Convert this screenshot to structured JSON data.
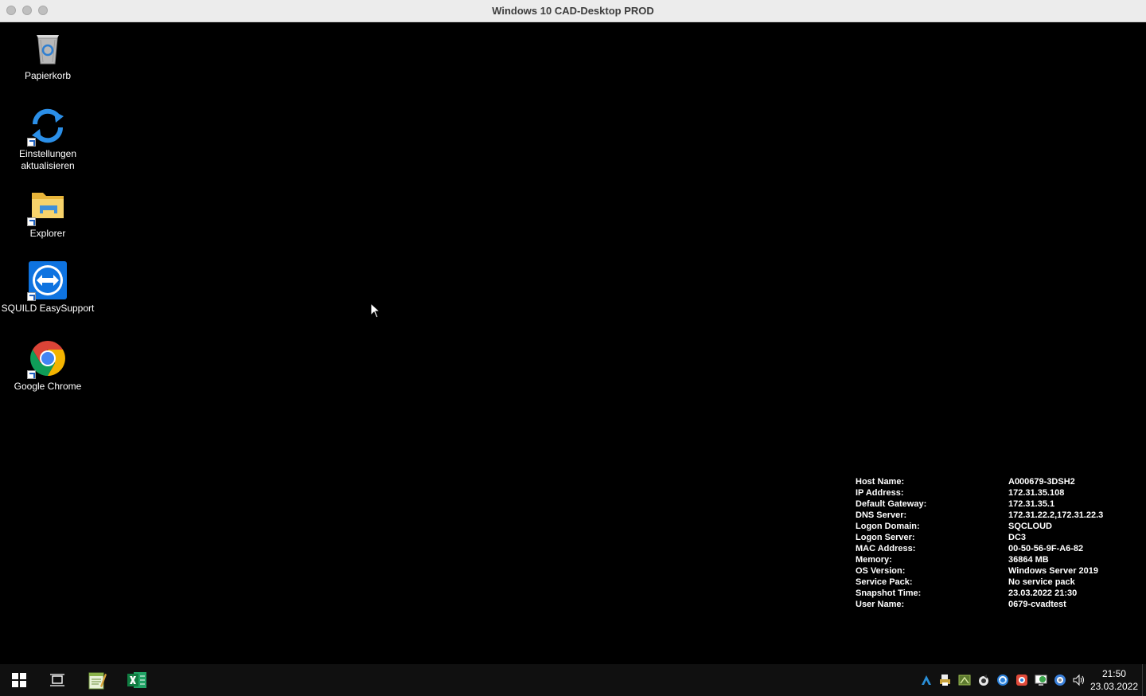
{
  "window": {
    "title": "Windows 10 CAD-Desktop PROD"
  },
  "desktop_icons": [
    {
      "label": "Papierkorb",
      "icon": "recycle-bin-icon"
    },
    {
      "label": "Einstellungen aktualisieren",
      "icon": "refresh-icon"
    },
    {
      "label": "Explorer",
      "icon": "folder-icon"
    },
    {
      "label": "SQUILD EasySupport",
      "icon": "teamviewer-icon"
    },
    {
      "label": "Google Chrome",
      "icon": "chrome-icon"
    }
  ],
  "bginfo": [
    {
      "key": "Host Name:",
      "value": "A000679-3DSH2"
    },
    {
      "key": "IP Address:",
      "value": "172.31.35.108"
    },
    {
      "key": "Default Gateway:",
      "value": "172.31.35.1"
    },
    {
      "key": "DNS Server:",
      "value": "172.31.22.2,172.31.22.3"
    },
    {
      "key": "Logon Domain:",
      "value": "SQCLOUD"
    },
    {
      "key": "Logon Server:",
      "value": "DC3"
    },
    {
      "key": "MAC Address:",
      "value": "00-50-56-9F-A6-82"
    },
    {
      "key": "Memory:",
      "value": "36864 MB"
    },
    {
      "key": "OS Version:",
      "value": "Windows Server 2019"
    },
    {
      "key": "Service Pack:",
      "value": "No service pack"
    },
    {
      "key": "Snapshot Time:",
      "value": "23.03.2022 21:30"
    },
    {
      "key": "User Name:",
      "value": "0679-cvadtest"
    }
  ],
  "taskbar": {
    "pinned": [
      "start-button",
      "task-view-button",
      "notepad-plus-button",
      "excel-button"
    ],
    "tray_icons": [
      "autodesk-icon",
      "printer-icon",
      "network-tool-icon",
      "app-tray-icon",
      "sync-tray-icon",
      "update-tray-icon",
      "screen-tray-icon",
      "vpn-tray-icon",
      "volume-icon"
    ],
    "time": "21:50",
    "date": "23.03.2022"
  }
}
